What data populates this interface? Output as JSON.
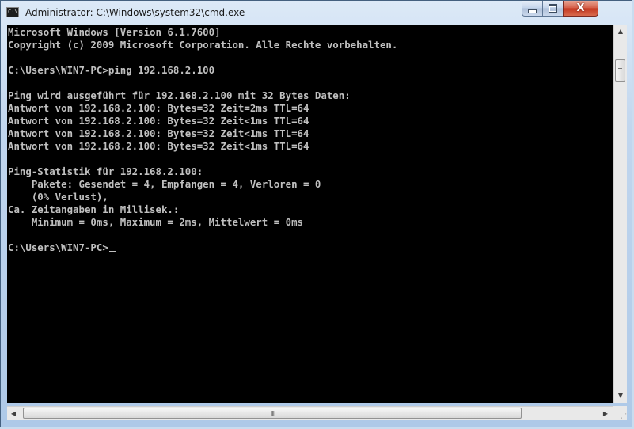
{
  "window": {
    "title": "Administrator: C:\\Windows\\system32\\cmd.exe",
    "icon_text": "C:\\",
    "controls": {
      "minimize": "minimize-icon",
      "maximize": "maximize-icon",
      "close": "close-icon",
      "close_glyph": "X"
    }
  },
  "console": {
    "lines": [
      "Microsoft Windows [Version 6.1.7600]",
      "Copyright (c) 2009 Microsoft Corporation. Alle Rechte vorbehalten.",
      "",
      "C:\\Users\\WIN7-PC>ping 192.168.2.100",
      "",
      "Ping wird ausgeführt für 192.168.2.100 mit 32 Bytes Daten:",
      "Antwort von 192.168.2.100: Bytes=32 Zeit=2ms TTL=64",
      "Antwort von 192.168.2.100: Bytes=32 Zeit<1ms TTL=64",
      "Antwort von 192.168.2.100: Bytes=32 Zeit<1ms TTL=64",
      "Antwort von 192.168.2.100: Bytes=32 Zeit<1ms TTL=64",
      "",
      "Ping-Statistik für 192.168.2.100:",
      "    Pakete: Gesendet = 4, Empfangen = 4, Verloren = 0",
      "    (0% Verlust),",
      "Ca. Zeitangaben in Millisek.:",
      "    Minimum = 0ms, Maximum = 2ms, Mittelwert = 0ms",
      "",
      "C:\\Users\\WIN7-PC>"
    ],
    "text_color": "#c0c0c0",
    "background": "#000000"
  },
  "scrollbars": {
    "up_arrow": "▲",
    "down_arrow": "▼",
    "left_arrow": "◀",
    "right_arrow": "▶",
    "h_thumb_grip": "III",
    "size_grip": "⋰"
  }
}
